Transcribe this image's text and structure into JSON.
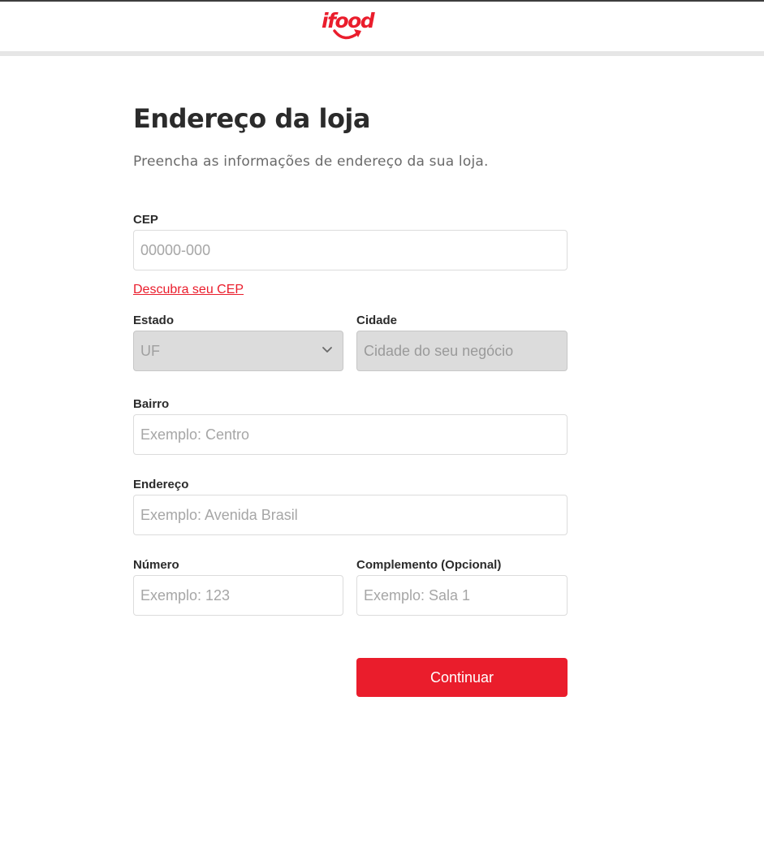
{
  "brand": {
    "logo_text": "ifood",
    "accent": "#ea1d2c"
  },
  "page": {
    "title": "Endereço da loja",
    "subtitle": "Preencha as informações de endereço da sua loja."
  },
  "form": {
    "cep": {
      "label": "CEP",
      "placeholder": "00000-000",
      "value": ""
    },
    "cep_link": "Descubra seu CEP",
    "estado": {
      "label": "Estado",
      "selected": "UF",
      "disabled": true
    },
    "cidade": {
      "label": "Cidade",
      "placeholder": "Cidade do seu negócio",
      "disabled": true
    },
    "bairro": {
      "label": "Bairro",
      "placeholder": "Exemplo: Centro"
    },
    "endereco": {
      "label": "Endereço",
      "placeholder": "Exemplo: Avenida Brasil"
    },
    "numero": {
      "label": "Número",
      "placeholder": "Exemplo: 123"
    },
    "complemento": {
      "label": "Complemento (Opcional)",
      "placeholder": "Exemplo: Sala 1"
    },
    "submit_label": "Continuar"
  }
}
